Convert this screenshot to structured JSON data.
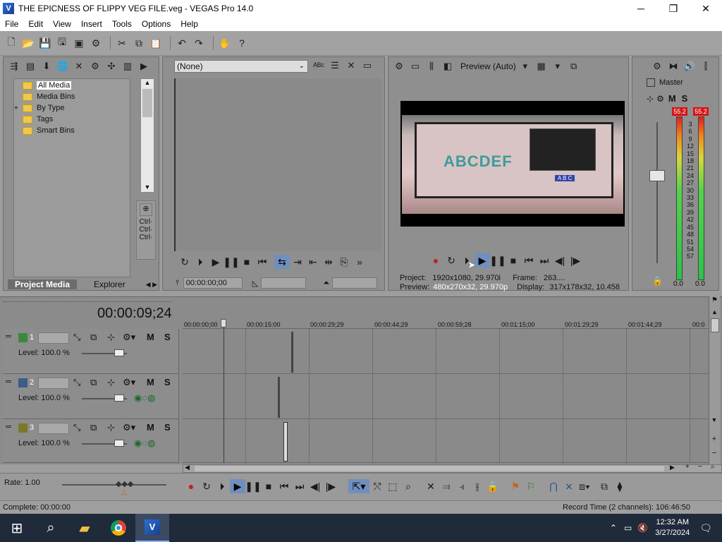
{
  "window": {
    "title": "THE EPICNESS OF FLIPPY VEG FILE.veg - VEGAS Pro 14.0",
    "app_icon": "vegas-icon",
    "minimize": "─",
    "maximize": "❐",
    "close": "✕"
  },
  "menu": [
    "File",
    "Edit",
    "View",
    "Insert",
    "Tools",
    "Options",
    "Help"
  ],
  "explorer": {
    "tree": [
      {
        "label": "All Media",
        "selected": true,
        "expander": ""
      },
      {
        "label": "Media Bins",
        "expander": ""
      },
      {
        "label": "By Type",
        "expander": "+"
      },
      {
        "label": "Tags",
        "expander": ""
      },
      {
        "label": "Smart Bins",
        "expander": ""
      }
    ],
    "right_col": [
      "Ctrl·",
      "Ctrl·",
      "Ctrl·"
    ],
    "tabs": {
      "active": "Project Media",
      "other": "Explorer"
    }
  },
  "trimmer": {
    "select_value": "(None)",
    "timecode": "00:00:00;00"
  },
  "preview": {
    "quality": "Preview (Auto)",
    "project_label": "Project:",
    "project_value": "1920x1080, 29.970i",
    "frame_label": "Frame:",
    "frame_value": "263....",
    "preview_label": "Preview:",
    "preview_value": "480x270x32, 29.970p",
    "display_label": "Display:",
    "display_value": "317x178x32, 10.458",
    "screen_text": "ABCDEF",
    "screen_badge": "A B C"
  },
  "master": {
    "title": "Master",
    "mute": "M",
    "solo": "S",
    "peak_left": "55.2",
    "peak_right": "55.2",
    "scale": [
      "3",
      "6",
      "9",
      "12",
      "15",
      "18",
      "21",
      "24",
      "27",
      "30",
      "33",
      "36",
      "39",
      "42",
      "45",
      "48",
      "51",
      "54",
      "57"
    ],
    "level_left": "0.0",
    "level_right": "0.0"
  },
  "timeline": {
    "cursor_time": "00:00:09;24",
    "ruler": [
      "00:00:00;00",
      "00:00:15:00",
      "00:00:29;29",
      "00:00:44;29",
      "00:00:59;28",
      "00:01:15;00",
      "00:01:29;29",
      "00:01:44;29",
      "00:0"
    ],
    "tracks": [
      {
        "number": "1",
        "level": "Level: 100.0 %",
        "mute": "M",
        "solo": "S",
        "color": "#3a8a3a"
      },
      {
        "number": "2",
        "level": "Level: 100.0 %",
        "mute": "M",
        "solo": "S",
        "color": "#3a5d8a"
      },
      {
        "number": "3",
        "level": "Level: 100.0 %",
        "mute": "M",
        "solo": "S",
        "color": "#7a7a2a"
      }
    ]
  },
  "bottom": {
    "rate": "Rate: 1.00"
  },
  "status": {
    "left": "Complete: 00:00:00",
    "right": "Record Time (2 channels): 106:46:50"
  },
  "taskbar": {
    "time": "12:32 AM",
    "date": "3/27/2024"
  }
}
